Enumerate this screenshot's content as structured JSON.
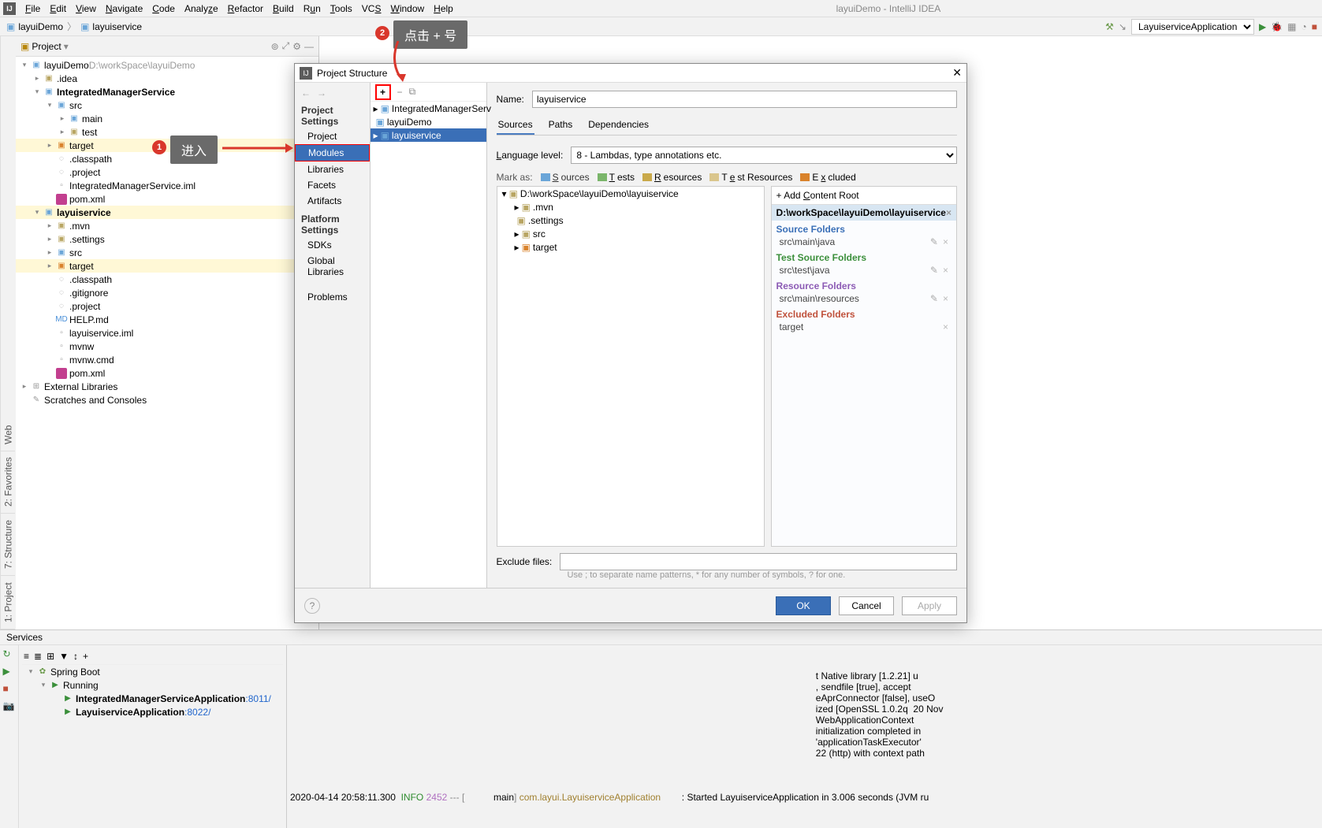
{
  "window": {
    "title": "layuiDemo - IntelliJ IDEA"
  },
  "menus": [
    "File",
    "Edit",
    "View",
    "Navigate",
    "Code",
    "Analyze",
    "Refactor",
    "Build",
    "Run",
    "Tools",
    "VCS",
    "Window",
    "Help"
  ],
  "breadcrumb": {
    "root": "layuiDemo",
    "child": "layuiservice"
  },
  "run_config": "LayuiserviceApplication",
  "project_panel": {
    "title": "Project",
    "tree": [
      {
        "d": 0,
        "tw": "▾",
        "icon": "folder-blue",
        "label": "layuiDemo",
        "suffix": "  D:\\workSpace\\layuiDemo",
        "suffixColor": "#999"
      },
      {
        "d": 1,
        "tw": "▸",
        "icon": "folder",
        "label": ".idea"
      },
      {
        "d": 1,
        "tw": "▾",
        "icon": "folder-blue",
        "label": "IntegratedManagerService",
        "bold": true
      },
      {
        "d": 2,
        "tw": "▾",
        "icon": "folder-blue",
        "label": "src"
      },
      {
        "d": 3,
        "tw": "▸",
        "icon": "folder-blue",
        "label": "main"
      },
      {
        "d": 3,
        "tw": "▸",
        "icon": "folder",
        "label": "test"
      },
      {
        "d": 2,
        "tw": "▸",
        "icon": "folder-orange",
        "label": "target",
        "sel": true
      },
      {
        "d": 2,
        "tw": "",
        "icon": "dot",
        "label": ".classpath"
      },
      {
        "d": 2,
        "tw": "",
        "icon": "dot",
        "label": ".project"
      },
      {
        "d": 2,
        "tw": "",
        "icon": "file",
        "label": "IntegratedManagerService.iml"
      },
      {
        "d": 2,
        "tw": "",
        "icon": "m",
        "label": "pom.xml"
      },
      {
        "d": 1,
        "tw": "▾",
        "icon": "folder-blue",
        "label": "layuiservice",
        "sel": true,
        "bold": true
      },
      {
        "d": 2,
        "tw": "▸",
        "icon": "folder",
        "label": ".mvn"
      },
      {
        "d": 2,
        "tw": "▸",
        "icon": "folder",
        "label": ".settings"
      },
      {
        "d": 2,
        "tw": "▸",
        "icon": "folder-blue",
        "label": "src"
      },
      {
        "d": 2,
        "tw": "▸",
        "icon": "folder-orange",
        "label": "target",
        "sel": true
      },
      {
        "d": 2,
        "tw": "",
        "icon": "dot",
        "label": ".classpath"
      },
      {
        "d": 2,
        "tw": "",
        "icon": "dot",
        "label": ".gitignore"
      },
      {
        "d": 2,
        "tw": "",
        "icon": "dot",
        "label": ".project"
      },
      {
        "d": 2,
        "tw": "",
        "icon": "md",
        "label": "HELP.md"
      },
      {
        "d": 2,
        "tw": "",
        "icon": "file",
        "label": "layuiservice.iml"
      },
      {
        "d": 2,
        "tw": "",
        "icon": "file",
        "label": "mvnw"
      },
      {
        "d": 2,
        "tw": "",
        "icon": "file",
        "label": "mvnw.cmd"
      },
      {
        "d": 2,
        "tw": "",
        "icon": "m",
        "label": "pom.xml"
      },
      {
        "d": 0,
        "tw": "▸",
        "icon": "lib",
        "label": "External Libraries"
      },
      {
        "d": 0,
        "tw": "",
        "icon": "scratch",
        "label": "Scratches and Consoles"
      }
    ]
  },
  "left_tabs": [
    "1: Project",
    "7: Structure",
    "2: Favorites",
    "Web"
  ],
  "services": {
    "title": "Services",
    "tree": [
      {
        "d": 0,
        "tw": "▾",
        "icon": "spring",
        "label": "Spring Boot"
      },
      {
        "d": 1,
        "tw": "▾",
        "icon": "run",
        "label": "Running"
      },
      {
        "d": 2,
        "tw": "",
        "icon": "run",
        "label": "IntegratedManagerServiceApplication",
        "port": ":8011/",
        "bold": true
      },
      {
        "d": 2,
        "tw": "",
        "icon": "run",
        "label": "LayuiserviceApplication",
        "port": ":8022/",
        "bold": true
      }
    ],
    "log_lines": [
      "t Native library [1.2.21] u",
      ", sendfile [true], accept ",
      "eAprConnector [false], useO",
      "ized [OpenSSL 1.0.2q  20 Nov",
      "WebApplicationContext",
      "initialization completed in ",
      "'applicationTaskExecutor'",
      "22 (http) with context path",
      ""
    ],
    "final_log": {
      "timestamp": "2020-04-14 20:58:11.300",
      "level": "INFO",
      "pid": "2452",
      "thread": "main",
      "logger": "com.layui.LayuiserviceApplication",
      "msg": ": Started LayuiserviceApplication in 3.006 seconds (JVM ru"
    }
  },
  "dialog": {
    "title": "Project Structure",
    "nav": {
      "sect1": "Project Settings",
      "items1": [
        "Project",
        "Modules",
        "Libraries",
        "Facets",
        "Artifacts"
      ],
      "sect2": "Platform Settings",
      "items2": [
        "SDKs",
        "Global Libraries"
      ],
      "problems": "Problems",
      "selected": "Modules"
    },
    "mid_tree": [
      {
        "d": 0,
        "tw": "▸",
        "icon": "folder-blue",
        "label": "IntegratedManagerServ"
      },
      {
        "d": 0,
        "tw": "",
        "icon": "folder-blue",
        "label": "layuiDemo"
      },
      {
        "d": 0,
        "tw": "▸",
        "icon": "folder-blue",
        "label": "layuiservice",
        "sel": true
      }
    ],
    "form": {
      "name_label": "Name:",
      "name_value": "layuiservice",
      "tabs": [
        "Sources",
        "Paths",
        "Dependencies"
      ],
      "active_tab": "Sources",
      "lang_label": "Language level:",
      "lang_value": "8 - Lambdas, type annotations etc.",
      "markas_label": "Mark as:",
      "markas": {
        "sources": "Sources",
        "tests": "Tests",
        "resources": "Resources",
        "test_resources": "Test Resources",
        "excluded": "Excluded"
      },
      "roots_tree": [
        {
          "d": 0,
          "tw": "▾",
          "icon": "folder",
          "label": "D:\\workSpace\\layuiDemo\\layuiservice"
        },
        {
          "d": 1,
          "tw": "▸",
          "icon": "folder",
          "label": ".mvn"
        },
        {
          "d": 1,
          "tw": "",
          "icon": "folder",
          "label": ".settings"
        },
        {
          "d": 1,
          "tw": "▸",
          "icon": "folder",
          "label": "src"
        },
        {
          "d": 1,
          "tw": "▸",
          "icon": "folder-orange",
          "label": "target"
        }
      ],
      "add_root": "+ Add Content Root",
      "root_path": "D:\\workSpace\\layuiDemo\\layuiservice",
      "cats": {
        "source_folders": "Source Folders",
        "source_item": "src\\main\\java",
        "test_source_folders": "Test Source Folders",
        "test_item": "src\\test\\java",
        "resource_folders": "Resource Folders",
        "resource_item": "src\\main\\resources",
        "excluded_folders": "Excluded Folders",
        "excluded_item": "target"
      },
      "exclude_label": "Exclude files:",
      "exclude_hint": "Use ; to separate name patterns, * for any number of symbols, ? for one."
    },
    "buttons": {
      "ok": "OK",
      "cancel": "Cancel",
      "apply": "Apply"
    }
  },
  "annot": {
    "step1": "1",
    "step1_text": "进入",
    "step2": "2",
    "step2_text": "点击 + 号"
  }
}
